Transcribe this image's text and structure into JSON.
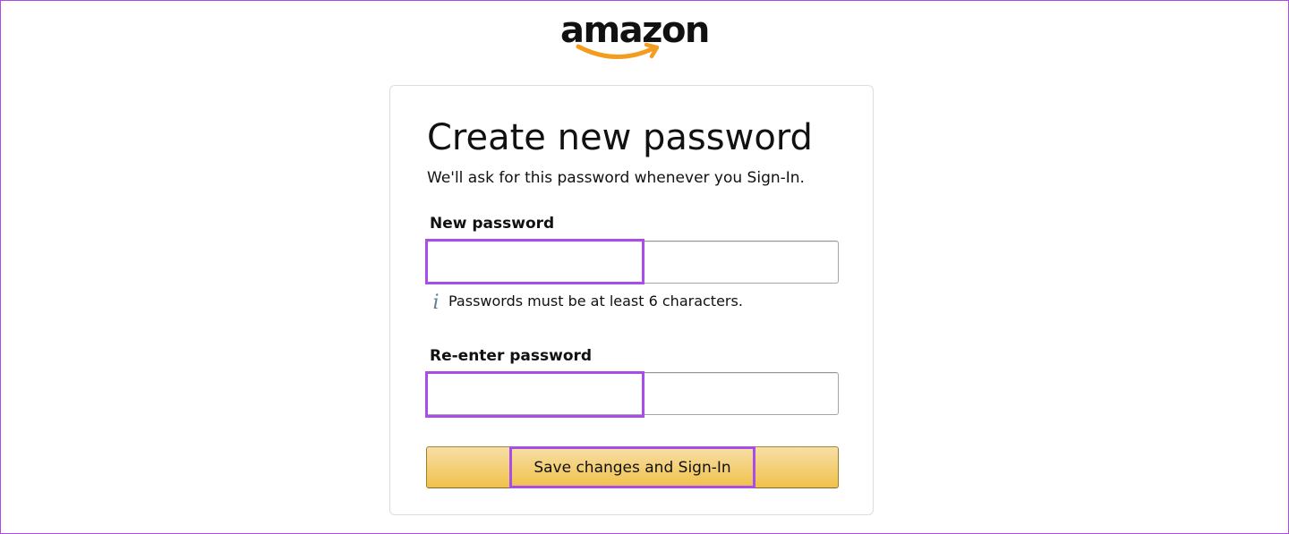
{
  "brand": {
    "logo_text": "amazon",
    "smile_color": "#f39c1e"
  },
  "form": {
    "title": "Create new password",
    "subtitle": "We'll ask for this password whenever you Sign-In.",
    "new_password_label": "New password",
    "new_password_value": "",
    "password_hint": "Passwords must be at least 6 characters.",
    "hint_icon": "info-icon",
    "reenter_password_label": "Re-enter password",
    "reenter_password_value": "",
    "submit_label": "Save changes and Sign-In"
  },
  "colors": {
    "highlight": "#a94de8",
    "button_top": "#f7dfa5",
    "button_bottom": "#f0c14b"
  }
}
